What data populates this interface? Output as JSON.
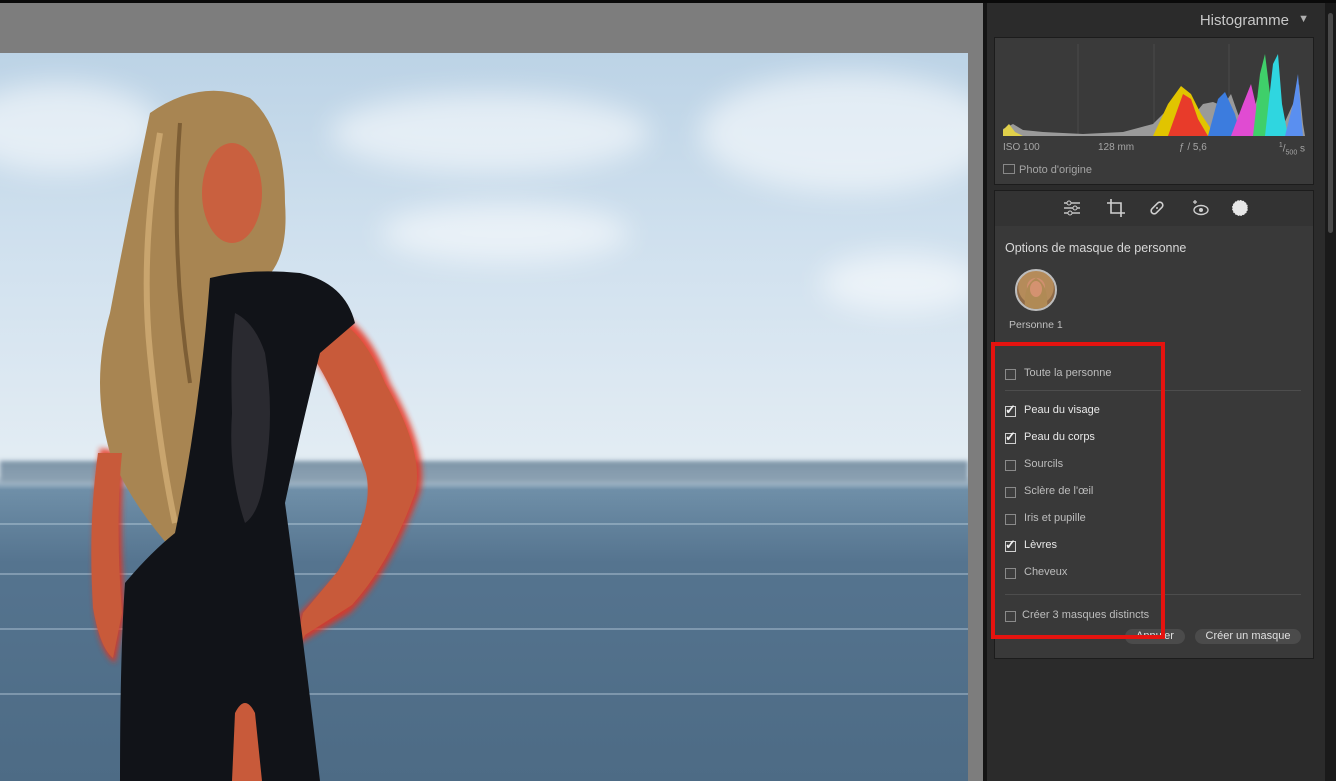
{
  "histogram": {
    "title": "Histogramme",
    "collapse_icon": "triangle-down-icon",
    "info": {
      "iso": "ISO 100",
      "focal": "128 mm",
      "aperture": "ƒ / 5,6",
      "shutter_num": "1",
      "shutter_den": "500",
      "shutter_unit": "s"
    },
    "original_photo_label": "Photo d'origine"
  },
  "tools": [
    "edit-sliders-icon",
    "crop-icon",
    "healing-icon",
    "red-eye-icon",
    "masking-icon"
  ],
  "mask_options": {
    "title": "Options de masque de personne",
    "person_label": "Personne 1",
    "whole_person": {
      "label": "Toute la personne",
      "checked": false
    },
    "parts": [
      {
        "label": "Peau du visage",
        "checked": true
      },
      {
        "label": "Peau du corps",
        "checked": true
      },
      {
        "label": "Sourcils",
        "checked": false
      },
      {
        "label": "Sclère de l'œil",
        "checked": false
      },
      {
        "label": "Iris et pupille",
        "checked": false
      },
      {
        "label": "Lèvres",
        "checked": true
      },
      {
        "label": "Cheveux",
        "checked": false
      }
    ],
    "separate_masks": {
      "label": "Créer 3 masques distincts",
      "checked": false
    },
    "cancel_label": "Annuler",
    "create_label": "Créer un masque"
  },
  "colors": {
    "highlight_outline": "#e5130f",
    "panel_bg": "#2b2b2b",
    "mask_overlay": "#e8321f"
  }
}
